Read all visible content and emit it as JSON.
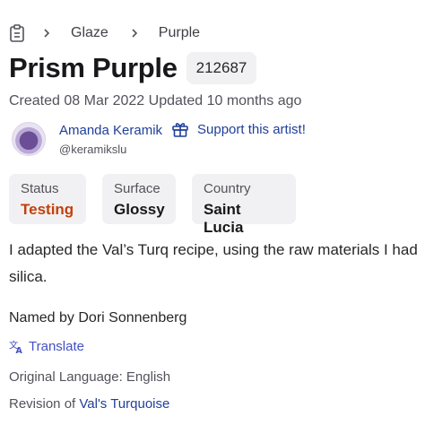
{
  "breadcrumb": {
    "icon": "clipboard-icon",
    "items": [
      {
        "label": "Glaze"
      },
      {
        "label": "Purple"
      }
    ]
  },
  "glaze": {
    "title": "Prism Purple",
    "id": "212687",
    "dates": "Created 08 Mar 2022 Updated 10 months ago"
  },
  "artist": {
    "name": "Amanda Keramik",
    "handle": "@keramikslu",
    "support_label": "Support this artist!",
    "support_icon": "gift-icon"
  },
  "stats": [
    {
      "key": "Status",
      "value": "Testing"
    },
    {
      "key": "Surface",
      "value": "Glossy"
    },
    {
      "key": "Country",
      "value": "Saint Lucia"
    }
  ],
  "description": {
    "line1": "I adapted the Val’s Turq recipe, using the raw materials I had",
    "line2": "silica."
  },
  "named_by": "Named by Dori Sonnenberg",
  "translate_label": "Translate",
  "original_language": "Original Language: English",
  "revision": {
    "prefix": "Revision of",
    "link": "Val's Turquoise"
  },
  "colors": {
    "link": "#1f3f9a",
    "status": "#c2410c",
    "card_bg": "#f1f1f3"
  }
}
